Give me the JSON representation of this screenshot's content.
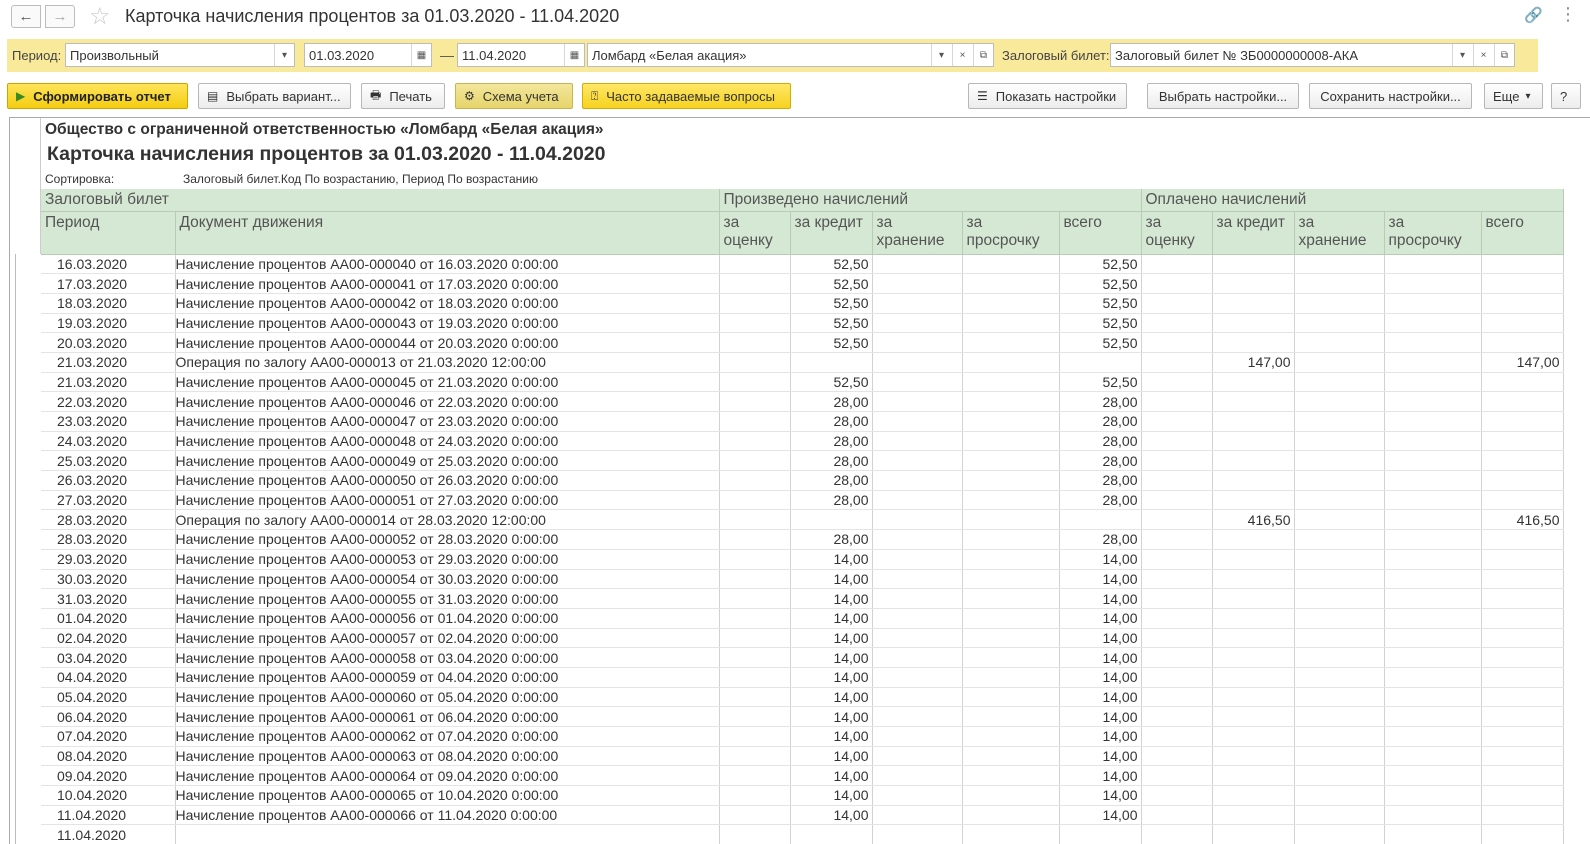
{
  "window": {
    "title": "Карточка начисления процентов за 01.03.2020 - 11.04.2020",
    "icons": [
      "back-arrow-icon",
      "forward-arrow-icon",
      "star-icon",
      "link-icon",
      "more-vert-icon"
    ]
  },
  "filters": {
    "period_label": "Период:",
    "period_value": "Произвольный",
    "date_from": "01.03.2020",
    "date_sep": "—",
    "date_to": "11.04.2020",
    "organization": "Ломбард «Белая акация»",
    "ticket_label": "Залоговый билет:",
    "ticket_value": "Залоговый билет № ЗБ0000000008-АКА",
    "background_color": "#f9e99b"
  },
  "toolbar": {
    "generate": "Сформировать отчет",
    "choose_variant": "Выбрать вариант...",
    "print": "Печать",
    "scheme": "Схема учета",
    "faq": "Часто задаваемые вопросы",
    "show_settings": "Показать настройки",
    "choose_settings": "Выбрать настройки...",
    "save_settings": "Сохранить настройки...",
    "more": "Еще",
    "help": "?"
  },
  "report": {
    "organization": "Общество с ограниченной ответственностью «Ломбард «Белая акация»",
    "title": "Карточка начисления процентов за 01.03.2020 - 11.04.2020",
    "sort_label": "Сортировка:",
    "sort_value": "Залоговый билет.Код По возрастанию, Период По возрастанию",
    "header_color": "#d5e8d4",
    "header": {
      "ticket": "Залоговый билет",
      "accrued": "Произведено начислений",
      "paid": "Оплачено начислений",
      "period": "Период",
      "document": "Документ движения",
      "sub": [
        "за оценку",
        "за кредит",
        "за хранение",
        "за просрочку",
        "всего"
      ]
    },
    "rows": [
      {
        "date": "16.03.2020",
        "doc": "Начисление процентов АА00-000040 от 16.03.2020 0:00:00",
        "credit": "52,50",
        "total": "52,50",
        "paid_credit": "",
        "paid_total": ""
      },
      {
        "date": "17.03.2020",
        "doc": "Начисление процентов АА00-000041 от 17.03.2020 0:00:00",
        "credit": "52,50",
        "total": "52,50",
        "paid_credit": "",
        "paid_total": ""
      },
      {
        "date": "18.03.2020",
        "doc": "Начисление процентов АА00-000042 от 18.03.2020 0:00:00",
        "credit": "52,50",
        "total": "52,50",
        "paid_credit": "",
        "paid_total": ""
      },
      {
        "date": "19.03.2020",
        "doc": "Начисление процентов АА00-000043 от 19.03.2020 0:00:00",
        "credit": "52,50",
        "total": "52,50",
        "paid_credit": "",
        "paid_total": ""
      },
      {
        "date": "20.03.2020",
        "doc": "Начисление процентов АА00-000044 от 20.03.2020 0:00:00",
        "credit": "52,50",
        "total": "52,50",
        "paid_credit": "",
        "paid_total": ""
      },
      {
        "date": "21.03.2020",
        "doc": "Операция по залогу АА00-000013 от 21.03.2020 12:00:00",
        "credit": "",
        "total": "",
        "paid_credit": "147,00",
        "paid_total": "147,00"
      },
      {
        "date": "21.03.2020",
        "doc": "Начисление процентов АА00-000045 от 21.03.2020 0:00:00",
        "credit": "52,50",
        "total": "52,50",
        "paid_credit": "",
        "paid_total": ""
      },
      {
        "date": "22.03.2020",
        "doc": "Начисление процентов АА00-000046 от 22.03.2020 0:00:00",
        "credit": "28,00",
        "total": "28,00",
        "paid_credit": "",
        "paid_total": ""
      },
      {
        "date": "23.03.2020",
        "doc": "Начисление процентов АА00-000047 от 23.03.2020 0:00:00",
        "credit": "28,00",
        "total": "28,00",
        "paid_credit": "",
        "paid_total": ""
      },
      {
        "date": "24.03.2020",
        "doc": "Начисление процентов АА00-000048 от 24.03.2020 0:00:00",
        "credit": "28,00",
        "total": "28,00",
        "paid_credit": "",
        "paid_total": ""
      },
      {
        "date": "25.03.2020",
        "doc": "Начисление процентов АА00-000049 от 25.03.2020 0:00:00",
        "credit": "28,00",
        "total": "28,00",
        "paid_credit": "",
        "paid_total": ""
      },
      {
        "date": "26.03.2020",
        "doc": "Начисление процентов АА00-000050 от 26.03.2020 0:00:00",
        "credit": "28,00",
        "total": "28,00",
        "paid_credit": "",
        "paid_total": ""
      },
      {
        "date": "27.03.2020",
        "doc": "Начисление процентов АА00-000051 от 27.03.2020 0:00:00",
        "credit": "28,00",
        "total": "28,00",
        "paid_credit": "",
        "paid_total": ""
      },
      {
        "date": "28.03.2020",
        "doc": "Операция по залогу АА00-000014 от 28.03.2020 12:00:00",
        "credit": "",
        "total": "",
        "paid_credit": "416,50",
        "paid_total": "416,50"
      },
      {
        "date": "28.03.2020",
        "doc": "Начисление процентов АА00-000052 от 28.03.2020 0:00:00",
        "credit": "28,00",
        "total": "28,00",
        "paid_credit": "",
        "paid_total": ""
      },
      {
        "date": "29.03.2020",
        "doc": "Начисление процентов АА00-000053 от 29.03.2020 0:00:00",
        "credit": "14,00",
        "total": "14,00",
        "paid_credit": "",
        "paid_total": ""
      },
      {
        "date": "30.03.2020",
        "doc": "Начисление процентов АА00-000054 от 30.03.2020 0:00:00",
        "credit": "14,00",
        "total": "14,00",
        "paid_credit": "",
        "paid_total": ""
      },
      {
        "date": "31.03.2020",
        "doc": "Начисление процентов АА00-000055 от 31.03.2020 0:00:00",
        "credit": "14,00",
        "total": "14,00",
        "paid_credit": "",
        "paid_total": ""
      },
      {
        "date": "01.04.2020",
        "doc": "Начисление процентов АА00-000056 от 01.04.2020 0:00:00",
        "credit": "14,00",
        "total": "14,00",
        "paid_credit": "",
        "paid_total": ""
      },
      {
        "date": "02.04.2020",
        "doc": "Начисление процентов АА00-000057 от 02.04.2020 0:00:00",
        "credit": "14,00",
        "total": "14,00",
        "paid_credit": "",
        "paid_total": ""
      },
      {
        "date": "03.04.2020",
        "doc": "Начисление процентов АА00-000058 от 03.04.2020 0:00:00",
        "credit": "14,00",
        "total": "14,00",
        "paid_credit": "",
        "paid_total": ""
      },
      {
        "date": "04.04.2020",
        "doc": "Начисление процентов АА00-000059 от 04.04.2020 0:00:00",
        "credit": "14,00",
        "total": "14,00",
        "paid_credit": "",
        "paid_total": ""
      },
      {
        "date": "05.04.2020",
        "doc": "Начисление процентов АА00-000060 от 05.04.2020 0:00:00",
        "credit": "14,00",
        "total": "14,00",
        "paid_credit": "",
        "paid_total": ""
      },
      {
        "date": "06.04.2020",
        "doc": "Начисление процентов АА00-000061 от 06.04.2020 0:00:00",
        "credit": "14,00",
        "total": "14,00",
        "paid_credit": "",
        "paid_total": ""
      },
      {
        "date": "07.04.2020",
        "doc": "Начисление процентов АА00-000062 от 07.04.2020 0:00:00",
        "credit": "14,00",
        "total": "14,00",
        "paid_credit": "",
        "paid_total": ""
      },
      {
        "date": "08.04.2020",
        "doc": "Начисление процентов АА00-000063 от 08.04.2020 0:00:00",
        "credit": "14,00",
        "total": "14,00",
        "paid_credit": "",
        "paid_total": ""
      },
      {
        "date": "09.04.2020",
        "doc": "Начисление процентов АА00-000064 от 09.04.2020 0:00:00",
        "credit": "14,00",
        "total": "14,00",
        "paid_credit": "",
        "paid_total": ""
      },
      {
        "date": "10.04.2020",
        "doc": "Начисление процентов АА00-000065 от 10.04.2020 0:00:00",
        "credit": "14,00",
        "total": "14,00",
        "paid_credit": "",
        "paid_total": ""
      },
      {
        "date": "11.04.2020",
        "doc": "Начисление процентов АА00-000066 от 11.04.2020 0:00:00",
        "credit": "14,00",
        "total": "14,00",
        "paid_credit": "",
        "paid_total": ""
      },
      {
        "date": "11.04.2020",
        "doc": "",
        "credit": "",
        "total": "",
        "paid_credit": "",
        "paid_total": ""
      }
    ]
  }
}
